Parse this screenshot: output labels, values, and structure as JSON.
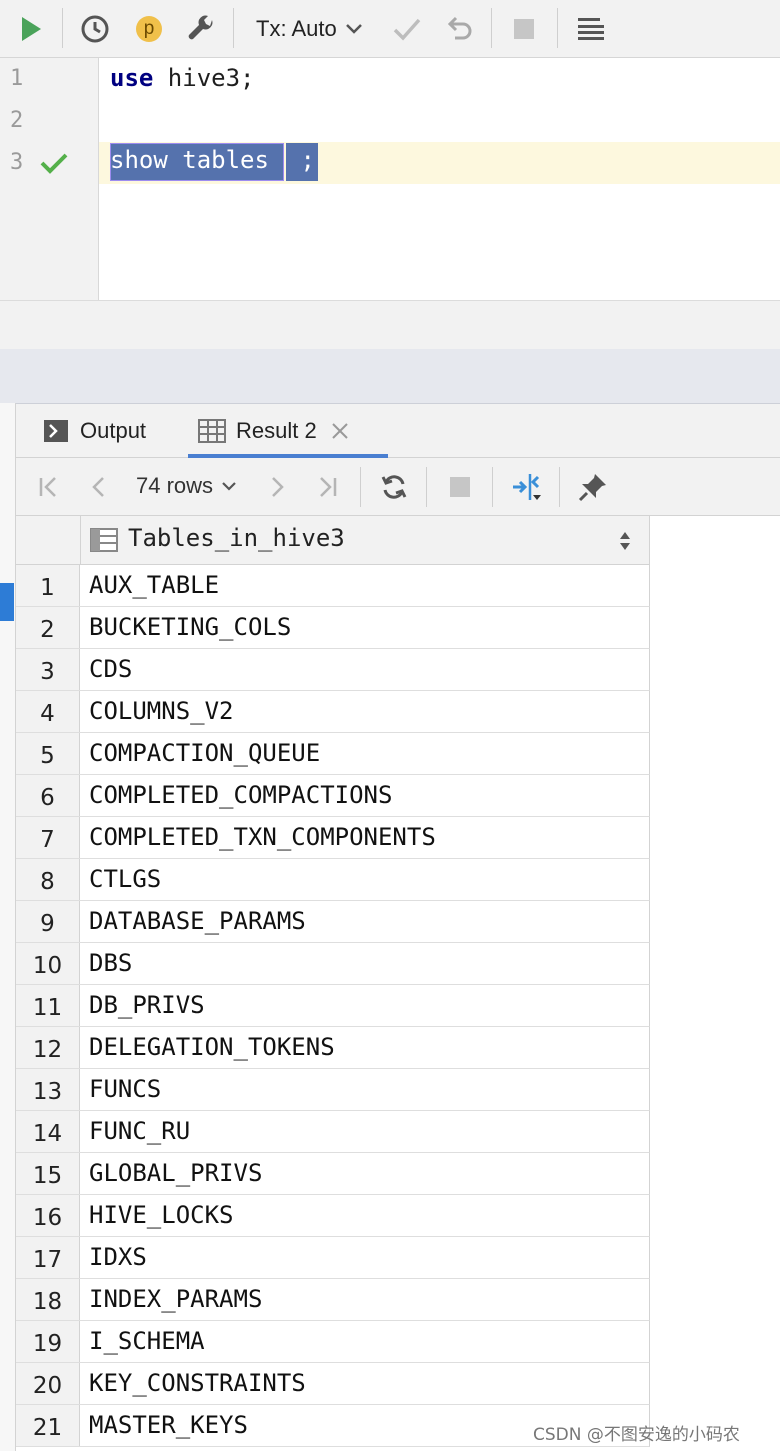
{
  "toolbar": {
    "tx_label": "Tx: Auto",
    "icons": [
      "run-icon",
      "history-icon",
      "p-badge-icon",
      "wrench-icon",
      "chevron-down-icon",
      "commit-check-icon",
      "rollback-icon",
      "stop-icon",
      "list-icon"
    ],
    "p_badge": "p"
  },
  "editor": {
    "lines": [
      {
        "num": "1",
        "kw": "use",
        "rest": " hive3;"
      },
      {
        "num": "2",
        "kw": "",
        "rest": ""
      },
      {
        "num": "3",
        "kw": "",
        "rest": ""
      }
    ],
    "selected_a": "show tables",
    "selected_b": " ;"
  },
  "results": {
    "tabs": [
      {
        "label": "Output",
        "icon": "console-icon"
      },
      {
        "label": "Result 2",
        "icon": "table-icon",
        "active": true
      }
    ],
    "rows_label": "74 rows",
    "column_header": "Tables_in_hive3",
    "rows": [
      {
        "n": "1",
        "v": "AUX_TABLE"
      },
      {
        "n": "2",
        "v": "BUCKETING_COLS"
      },
      {
        "n": "3",
        "v": "CDS"
      },
      {
        "n": "4",
        "v": "COLUMNS_V2"
      },
      {
        "n": "5",
        "v": "COMPACTION_QUEUE"
      },
      {
        "n": "6",
        "v": "COMPLETED_COMPACTIONS"
      },
      {
        "n": "7",
        "v": "COMPLETED_TXN_COMPONENTS"
      },
      {
        "n": "8",
        "v": "CTLGS"
      },
      {
        "n": "9",
        "v": "DATABASE_PARAMS"
      },
      {
        "n": "10",
        "v": "DBS"
      },
      {
        "n": "11",
        "v": "DB_PRIVS"
      },
      {
        "n": "12",
        "v": "DELEGATION_TOKENS"
      },
      {
        "n": "13",
        "v": "FUNCS"
      },
      {
        "n": "14",
        "v": "FUNC_RU"
      },
      {
        "n": "15",
        "v": "GLOBAL_PRIVS"
      },
      {
        "n": "16",
        "v": "HIVE_LOCKS"
      },
      {
        "n": "17",
        "v": "IDXS"
      },
      {
        "n": "18",
        "v": "INDEX_PARAMS"
      },
      {
        "n": "19",
        "v": "I_SCHEMA"
      },
      {
        "n": "20",
        "v": "KEY_CONSTRAINTS"
      },
      {
        "n": "21",
        "v": "MASTER_KEYS"
      }
    ]
  },
  "watermark": "CSDN @不图安逸的小码农",
  "colors": {
    "run": "#4aa35a",
    "check": "#54b04a",
    "selection": "#5572ad",
    "accent": "#4a7fd1",
    "badge": "#f0c04a",
    "keyword": "#000080"
  }
}
